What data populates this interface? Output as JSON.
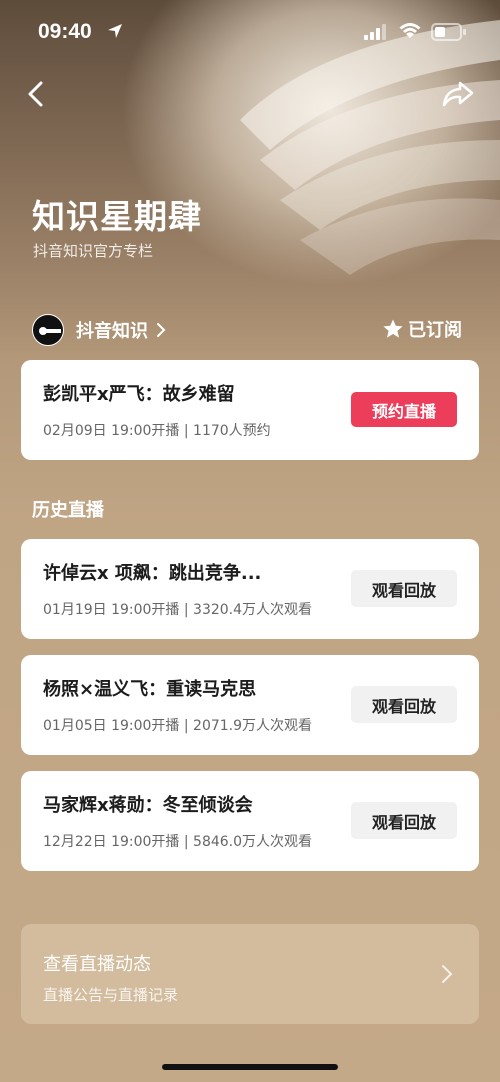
{
  "status_bar": {
    "time": "09:40"
  },
  "header": {
    "title": "知识星期肆",
    "subtitle": "抖音知识官方专栏"
  },
  "author": {
    "name": "抖音知识",
    "subscribe_label": "已订阅"
  },
  "upcoming": {
    "title": "彭凯平x严飞：故乡难留",
    "meta": "02月09日 19:00开播 | 1170人预约",
    "button": "预约直播"
  },
  "history": {
    "section_title": "历史直播",
    "items": [
      {
        "title": "许倬云x 项飙：跳出竞争...",
        "meta": "01月19日 19:00开播 | 3320.4万人次观看",
        "button": "观看回放"
      },
      {
        "title": "杨照×温义飞：重读马克思",
        "meta": "01月05日 19:00开播 | 2071.9万人次观看",
        "button": "观看回放"
      },
      {
        "title": "马家辉x蒋勋：冬至倾谈会",
        "meta": "12月22日 19:00开播 | 5846.0万人次观看",
        "button": "观看回放"
      }
    ]
  },
  "live_feed": {
    "title": "查看直播动态",
    "subtitle": "直播公告与直播记录"
  },
  "colors": {
    "accent": "#ec3e5a",
    "background": "#c4a988"
  },
  "icons": [
    "location-arrow-icon",
    "signal-icon",
    "wifi-icon",
    "battery-icon",
    "back-icon",
    "share-icon",
    "chevron-right-icon",
    "star-icon"
  ]
}
